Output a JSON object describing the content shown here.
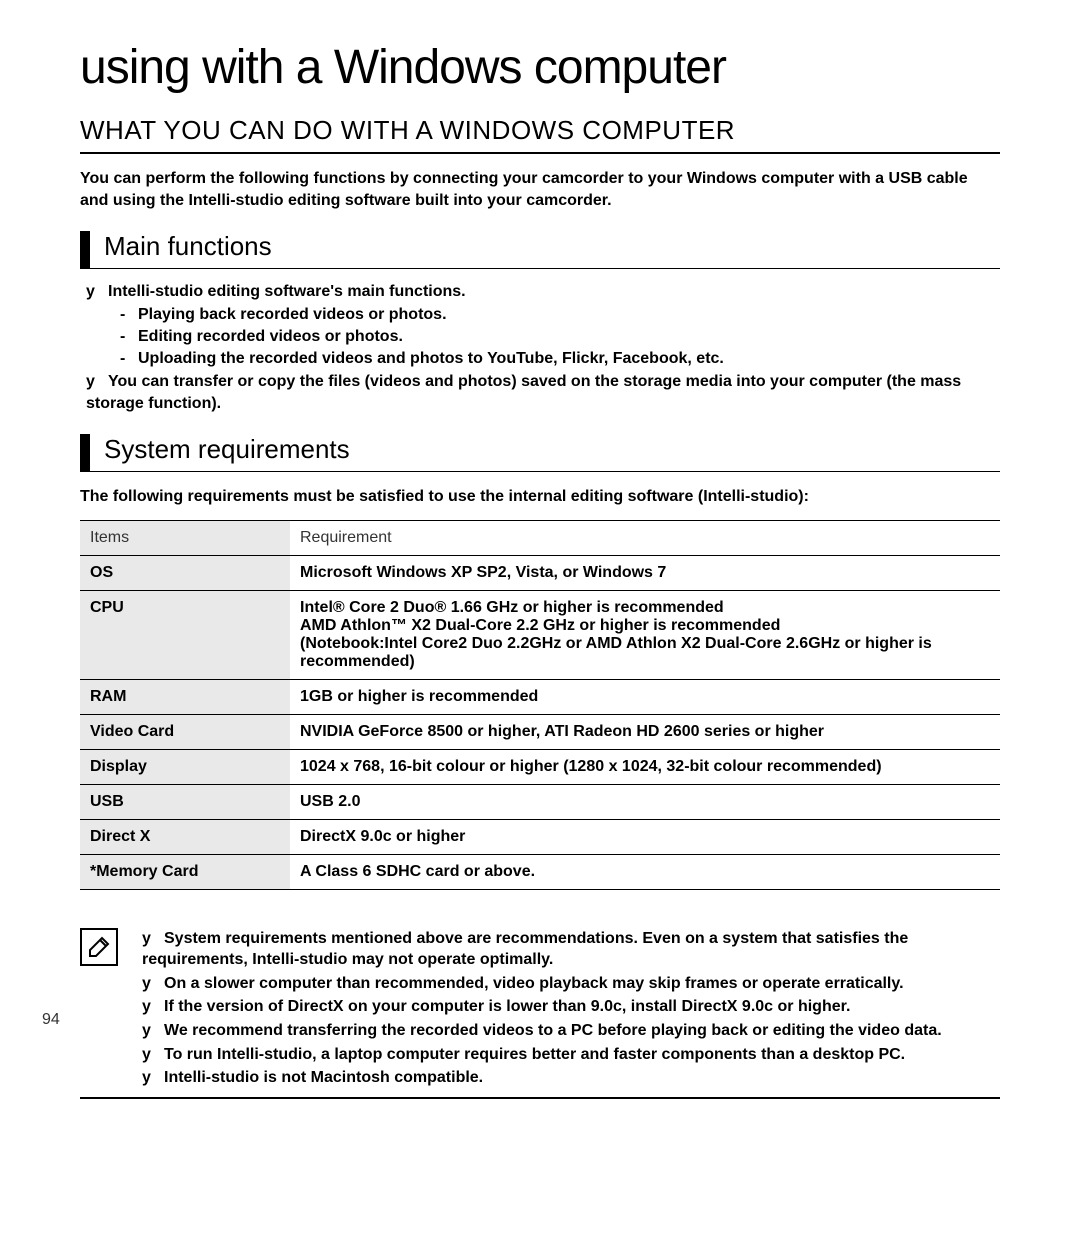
{
  "page_number": "94",
  "chapter_title": "using with a Windows computer",
  "section_title": "WHAT YOU CAN DO WITH A WINDOWS COMPUTER",
  "intro": "You can perform the following functions by connecting your camcorder to your Windows computer with a USB cable and using the Intelli-studio editing software built into your camcorder.",
  "main_functions": {
    "heading": "Main functions",
    "items": [
      "Intelli-studio editing software's main functions.",
      "Playing back recorded videos or photos.",
      "Editing recorded videos or photos.",
      "Uploading the recorded videos and photos to YouTube, Flickr, Facebook, etc.",
      "You can transfer or copy the files (videos and photos) saved on the storage media into your computer (the mass storage function)."
    ]
  },
  "system_requirements": {
    "heading": "System requirements",
    "intro": "The following requirements must be satisfied to use the internal editing software (Intelli-studio):",
    "columns": {
      "items": "Items",
      "req": "Requirement"
    },
    "rows": {
      "os": {
        "item": "OS",
        "req": "Microsoft Windows XP SP2, Vista, or Windows 7"
      },
      "cpu": {
        "item": "CPU",
        "req1": "Intel® Core 2 Duo® 1.66 GHz or higher is recommended",
        "req2": "AMD Athlon™ X2 Dual-Core 2.2 GHz or higher is recommended",
        "req3": "(Notebook:Intel Core2 Duo 2.2GHz or AMD Athlon X2 Dual-Core 2.6GHz or higher is recommended)"
      },
      "ram": {
        "item": "RAM",
        "req": "1GB or higher is recommended"
      },
      "video": {
        "item": "Video Card",
        "req": "NVIDIA GeForce 8500 or higher, ATI Radeon HD 2600 series or higher"
      },
      "display": {
        "item": "Display",
        "req": "1024 x 768, 16-bit colour or higher (1280 x 1024, 32-bit colour recommended)"
      },
      "usb": {
        "item": "USB",
        "req": "USB 2.0"
      },
      "directx": {
        "item": "Direct X",
        "req": "DirectX 9.0c or higher"
      },
      "memcard": {
        "item": "*Memory Card",
        "req": "A Class 6 SDHC card or above."
      }
    }
  },
  "notes": [
    "System requirements mentioned above are recommendations. Even on a system that satisfies the requirements, Intelli-studio may not operate optimally.",
    "On a slower computer than recommended, video playback may skip frames or operate erratically.",
    "If the version of DirectX on your computer is lower than 9.0c, install DirectX 9.0c or higher.",
    "We recommend transferring the recorded videos to a PC before playing back or editing the video data.",
    "To run Intelli-studio, a laptop computer requires better and faster components than a desktop PC.",
    "Intelli-studio is not Macintosh compatible."
  ]
}
